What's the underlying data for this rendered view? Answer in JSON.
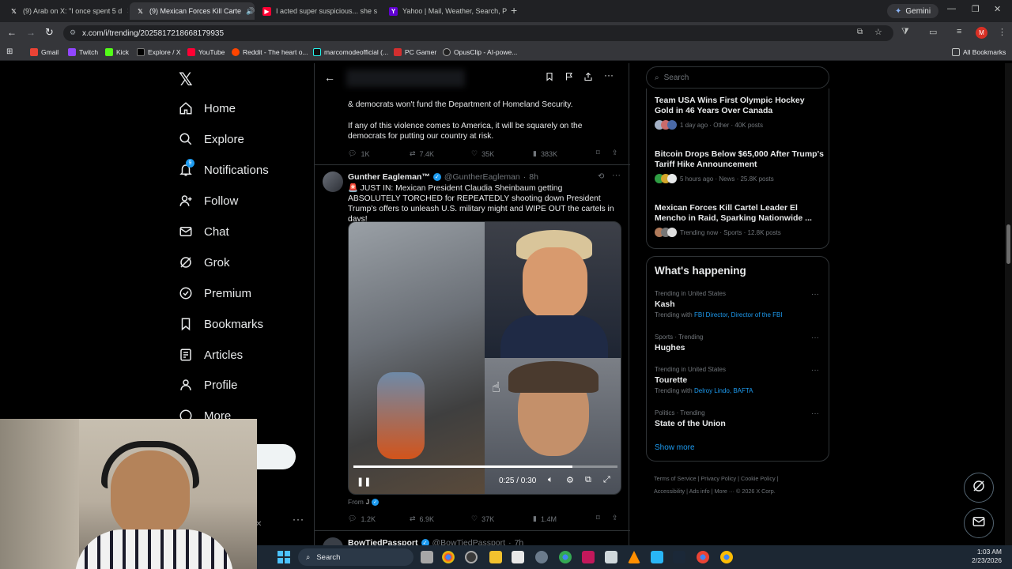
{
  "browser": {
    "tabs": [
      {
        "title": "(9) Arab on X: \"I once spent 5 d",
        "icon": "x-logo"
      },
      {
        "title": "(9) Mexican Forces Kill Carte",
        "icon": "x-logo"
      },
      {
        "title": "I acted super suspicious... she s",
        "icon": "youtube-logo"
      },
      {
        "title": "Yahoo | Mail, Weather, Search, P",
        "icon": "yahoo-logo"
      }
    ],
    "gemini_label": "Gemini",
    "url": "x.com/i/trending/2025817218668179935",
    "bookmarks": [
      "Gmail",
      "Twitch",
      "Kick",
      "Explore / X",
      "YouTube",
      "Reddit - The heart o...",
      "marcomodeofficial (...",
      "PC Gamer",
      "OpusClip - AI-powe..."
    ],
    "all_bookmarks": "All Bookmarks",
    "profile_initial": "M"
  },
  "nav": {
    "items": [
      "Home",
      "Explore",
      "Notifications",
      "Follow",
      "Chat",
      "Grok",
      "Premium",
      "Bookmarks",
      "Articles",
      "Profile",
      "More"
    ],
    "notif_badge": "9"
  },
  "feed": {
    "prev_tweet_lines": [
      "& democrats won't fund the Department of Homeland Security.",
      "If any of this violence comes to America, it will be squarely on the democrats for putting our country at risk."
    ],
    "prev_stats": {
      "replies": "1K",
      "reposts": "7.4K",
      "likes": "35K",
      "views": "383K"
    },
    "tweet": {
      "name": "Gunther Eagleman™",
      "handle": "@GuntherEagleman",
      "time": "8h",
      "text": "🚨 JUST IN: Mexican President Claudia Sheinbaum getting ABSOLUTELY TORCHED for REPEATEDLY shooting down President Trump's offers to unleash U.S. military might and WIPE OUT the cartels in days!",
      "video_time": "0:25 / 0:30",
      "video_progress": 0.83,
      "from": "From",
      "from_name": "J",
      "stats": {
        "replies": "1.2K",
        "reposts": "6.9K",
        "likes": "37K",
        "views": "1.4M"
      }
    },
    "next_tweet": {
      "name": "BowTiedPassport",
      "handle": "@BowTiedPassport",
      "time": "7h"
    }
  },
  "sidebar": {
    "search_placeholder": "Search",
    "news": [
      {
        "title": "Team USA Wins First Olympic Hockey Gold in 46 Years Over Canada",
        "meta": "1 day ago · Other · 40K posts"
      },
      {
        "title": "Bitcoin Drops Below $65,000 After Trump's Tariff Hike Announcement",
        "meta": "5 hours ago · News · 25.8K posts"
      },
      {
        "title": "Mexican Forces Kill Cartel Leader El Mencho in Raid, Sparking Nationwide ...",
        "meta": "Trending now · Sports · 12.8K posts"
      }
    ],
    "whats_happening": "What's happening",
    "trends": [
      {
        "context": "Trending in United States",
        "title": "Kash",
        "with_label": "Trending with",
        "with": "FBI Director, Director of the FBI"
      },
      {
        "context": "Sports · Trending",
        "title": "Hughes",
        "with_label": "",
        "with": ""
      },
      {
        "context": "Trending in United States",
        "title": "Tourette",
        "with_label": "Trending with",
        "with": "Delroy Lindo, BAFTA"
      },
      {
        "context": "Politics · Trending",
        "title": "State of the Union",
        "with_label": "",
        "with": ""
      }
    ],
    "show_more": "Show more",
    "footer": [
      "Terms of Service",
      "Privacy Policy",
      "Cookie Policy",
      "Accessibility",
      "Ads info",
      "More ···",
      "© 2026 X Corp."
    ]
  },
  "taskbar": {
    "search": "Search",
    "time": "1:03 AM",
    "date": "2/23/2026"
  }
}
